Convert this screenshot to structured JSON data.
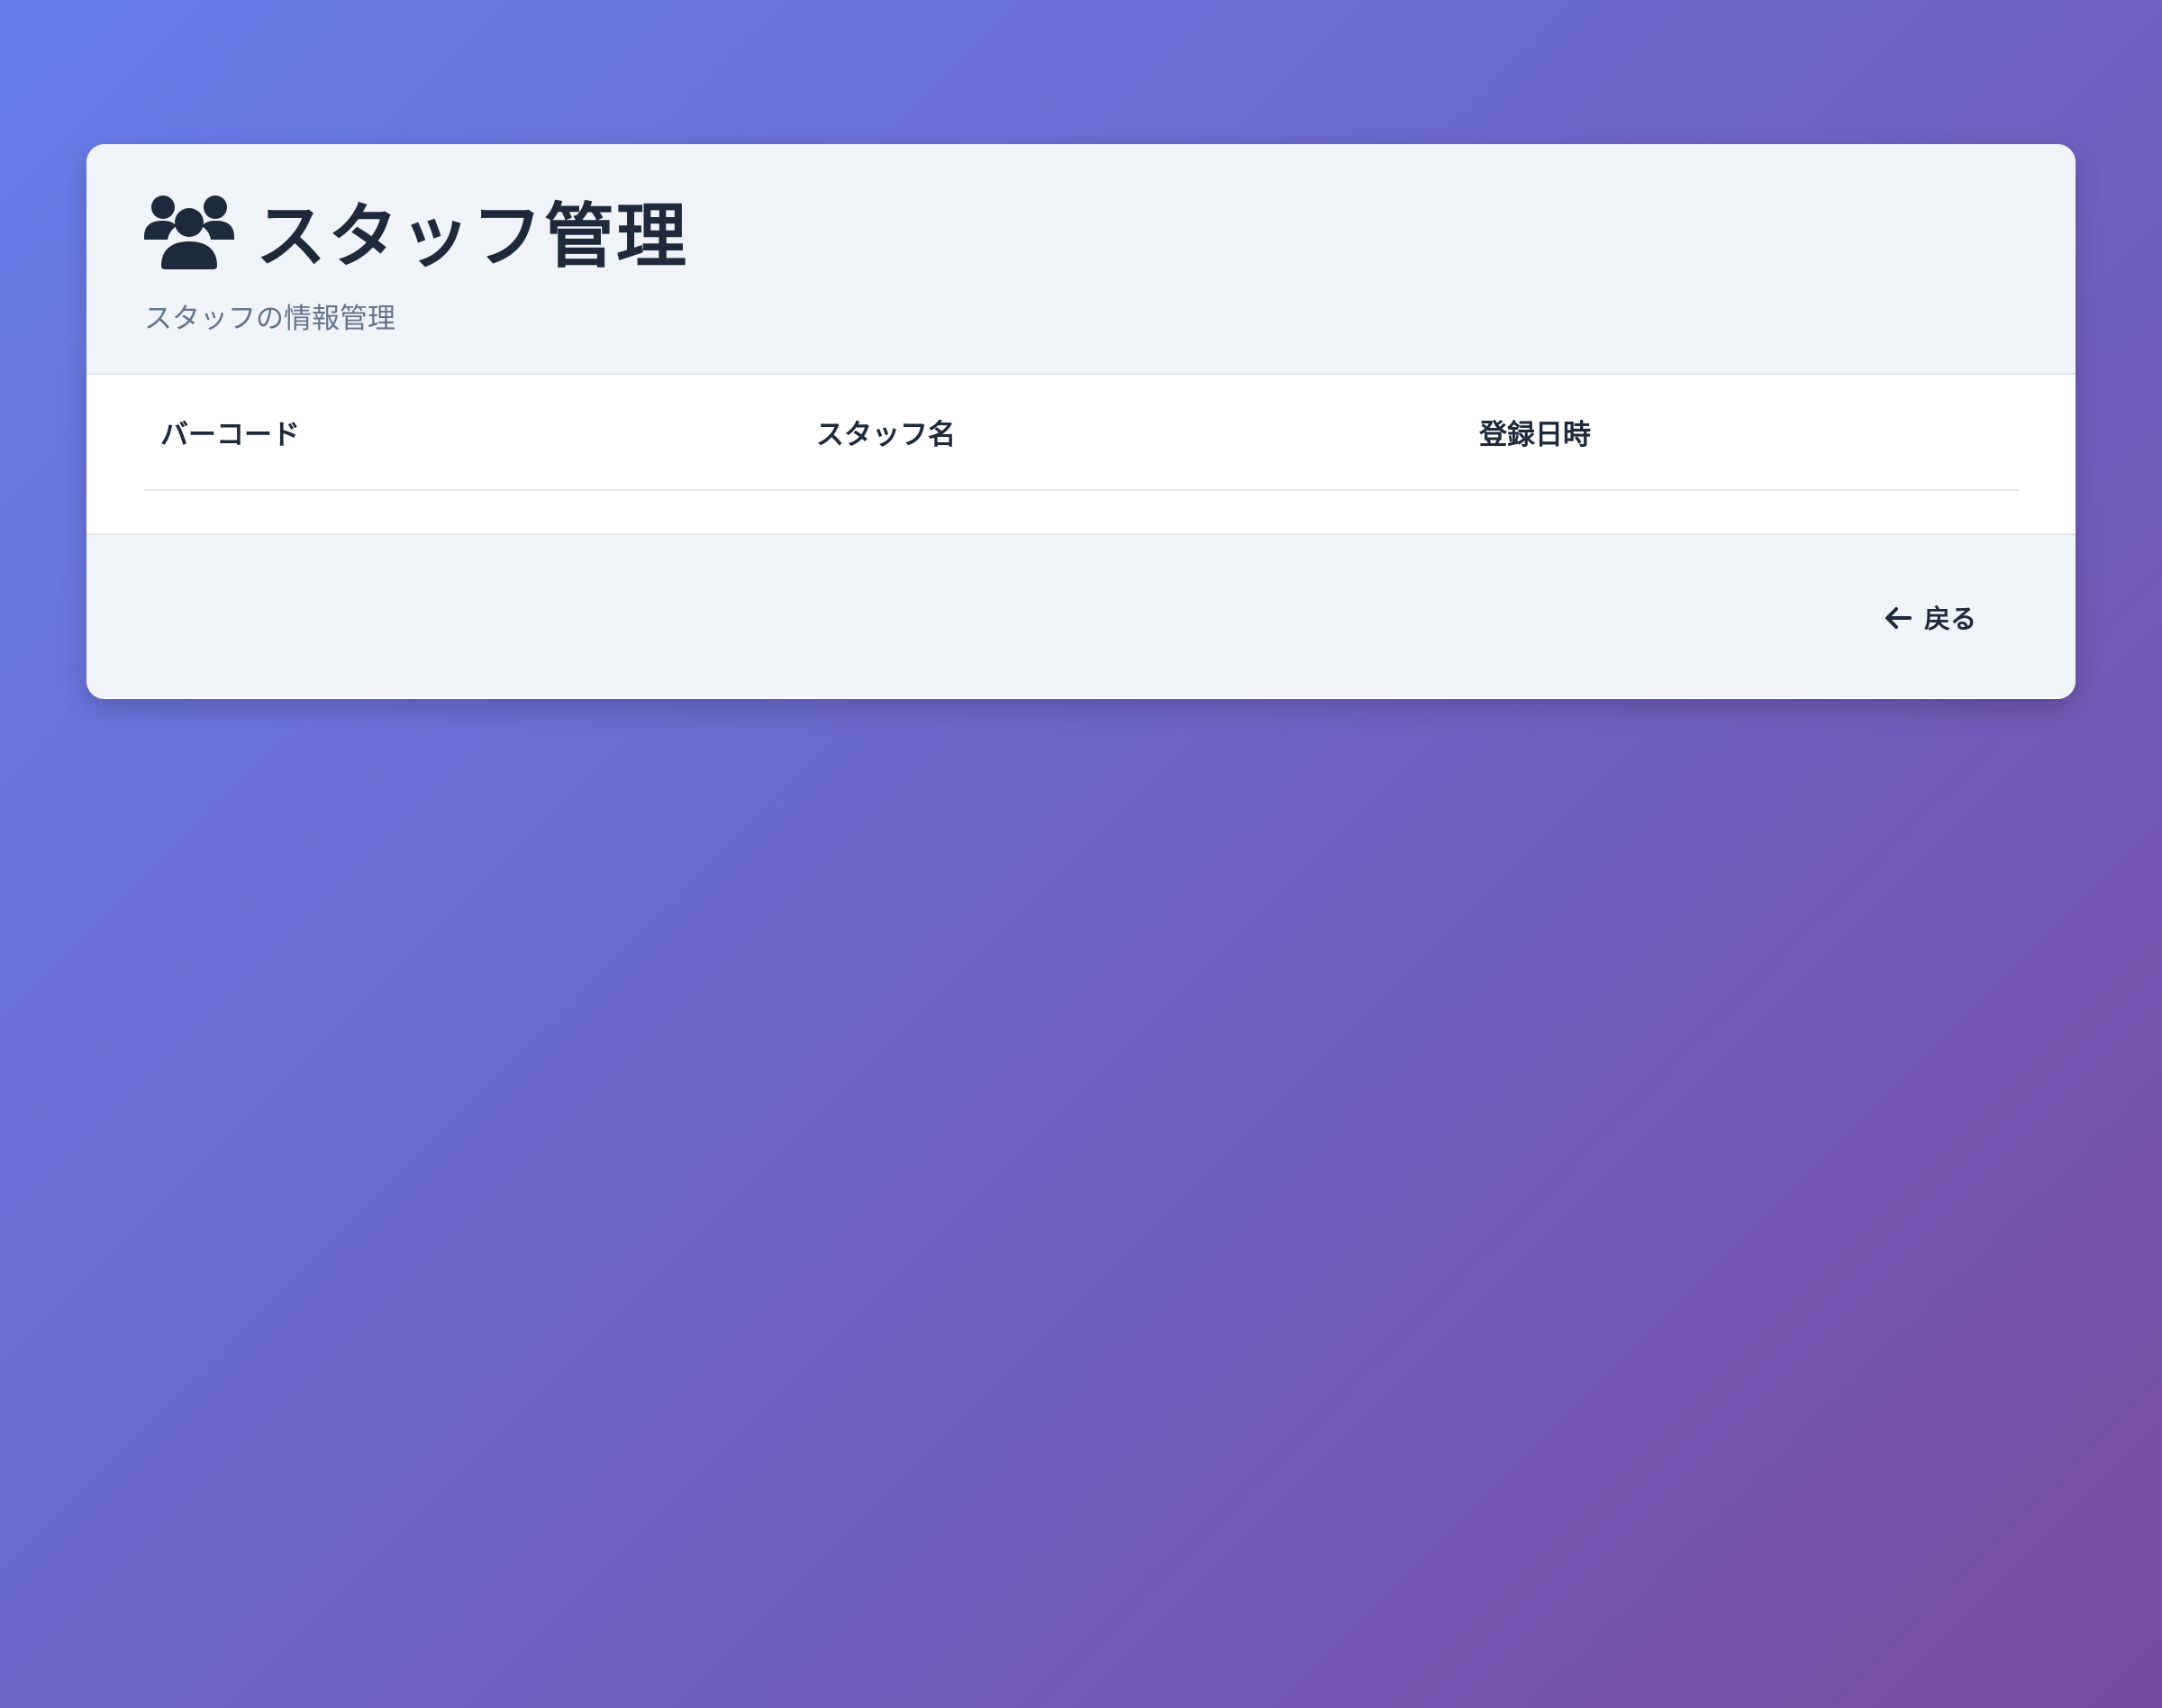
{
  "header": {
    "icon": "users-icon",
    "title": "スタッフ管理",
    "subtitle": "スタッフの情報管理"
  },
  "table": {
    "columns": [
      "バーコード",
      "スタッフ名",
      "登録日時"
    ],
    "rows": []
  },
  "footer": {
    "back_icon": "arrow-left-icon",
    "back_label": "戻る"
  },
  "colors": {
    "background_start": "#667eea",
    "background_end": "#764ba2",
    "text_primary": "#1e293b",
    "text_secondary": "#64748b",
    "panel": "#f0f4f8"
  }
}
